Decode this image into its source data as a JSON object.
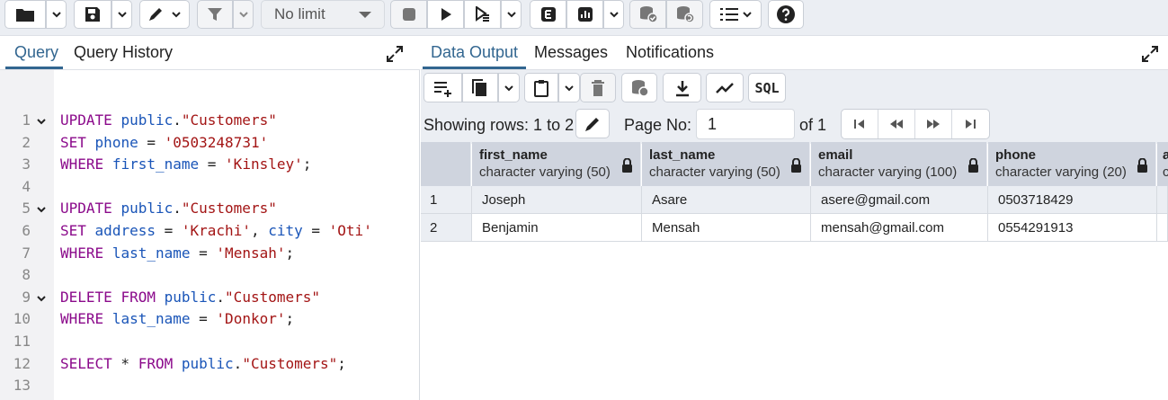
{
  "toolbar": {
    "row_limit": "No limit",
    "icons": [
      "folder-icon",
      "save-icon",
      "edit-icon",
      "filter-icon",
      "stop-icon",
      "execute-icon",
      "execute-script-icon",
      "explain-icon",
      "explain-analyze-icon",
      "commit-icon",
      "rollback-icon",
      "macros-icon",
      "help-icon"
    ]
  },
  "query_panel": {
    "tabs": [
      "Query",
      "Query History"
    ],
    "active_tab": "Query",
    "lines": [
      {
        "n": "1",
        "fold": true
      },
      {
        "n": "2",
        "fold": false
      },
      {
        "n": "3",
        "fold": false
      },
      {
        "n": "4",
        "fold": false
      },
      {
        "n": "5",
        "fold": true
      },
      {
        "n": "6",
        "fold": false
      },
      {
        "n": "7",
        "fold": false
      },
      {
        "n": "8",
        "fold": false
      },
      {
        "n": "9",
        "fold": true
      },
      {
        "n": "10",
        "fold": false
      },
      {
        "n": "11",
        "fold": false
      },
      {
        "n": "12",
        "fold": false
      },
      {
        "n": "13",
        "fold": false
      }
    ],
    "code": {
      "l1": [
        "UPDATE",
        " ",
        "public",
        ".",
        "\"Customers\""
      ],
      "l2": [
        "SET",
        " ",
        "phone",
        " = ",
        "'0503248731'"
      ],
      "l3": [
        "WHERE",
        " ",
        "first_name",
        " = ",
        "'Kinsley'",
        ";"
      ],
      "l5": [
        "UPDATE",
        " ",
        "public",
        ".",
        "\"Customers\""
      ],
      "l6": [
        "SET",
        " ",
        "address",
        " = ",
        "'Krachi'",
        ", ",
        "city",
        " = ",
        "'Oti'"
      ],
      "l7": [
        "WHERE",
        " ",
        "last_name",
        " = ",
        "'Mensah'",
        ";"
      ],
      "l9": [
        "DELETE",
        " ",
        "FROM",
        " ",
        "public",
        ".",
        "\"Customers\""
      ],
      "l10": [
        "WHERE",
        " ",
        "last_name",
        " = ",
        "'Donkor'",
        ";"
      ],
      "l12": [
        "SELECT",
        " * ",
        "FROM",
        " ",
        "public",
        ".",
        "\"Customers\"",
        ";"
      ]
    }
  },
  "output_panel": {
    "tabs": [
      "Data Output",
      "Messages",
      "Notifications"
    ],
    "active_tab": "Data Output",
    "sql_label": "SQL",
    "showing_rows": "Showing rows: 1 to 2",
    "page_no_label": "Page No:",
    "page_no": "1",
    "of_pages": "of 1",
    "columns": [
      {
        "name": "first_name",
        "type": "character varying (50)"
      },
      {
        "name": "last_name",
        "type": "character varying (50)"
      },
      {
        "name": "email",
        "type": "character varying (100)"
      },
      {
        "name": "phone",
        "type": "character varying (20)"
      },
      {
        "name": "a",
        "type": "c"
      }
    ],
    "rows": [
      {
        "num": "1",
        "cells": [
          "Joseph",
          "Asare",
          "asere@gmail.com",
          "0503718429"
        ]
      },
      {
        "num": "2",
        "cells": [
          "Benjamin",
          "Mensah",
          "mensah@gmail.com",
          "0554291913"
        ]
      }
    ]
  },
  "colors": {
    "accent": "#326690",
    "keyword": "#8b0a8b",
    "identifier": "#1a55b8",
    "string": "#a31515",
    "header_bg": "#cfd4de"
  }
}
